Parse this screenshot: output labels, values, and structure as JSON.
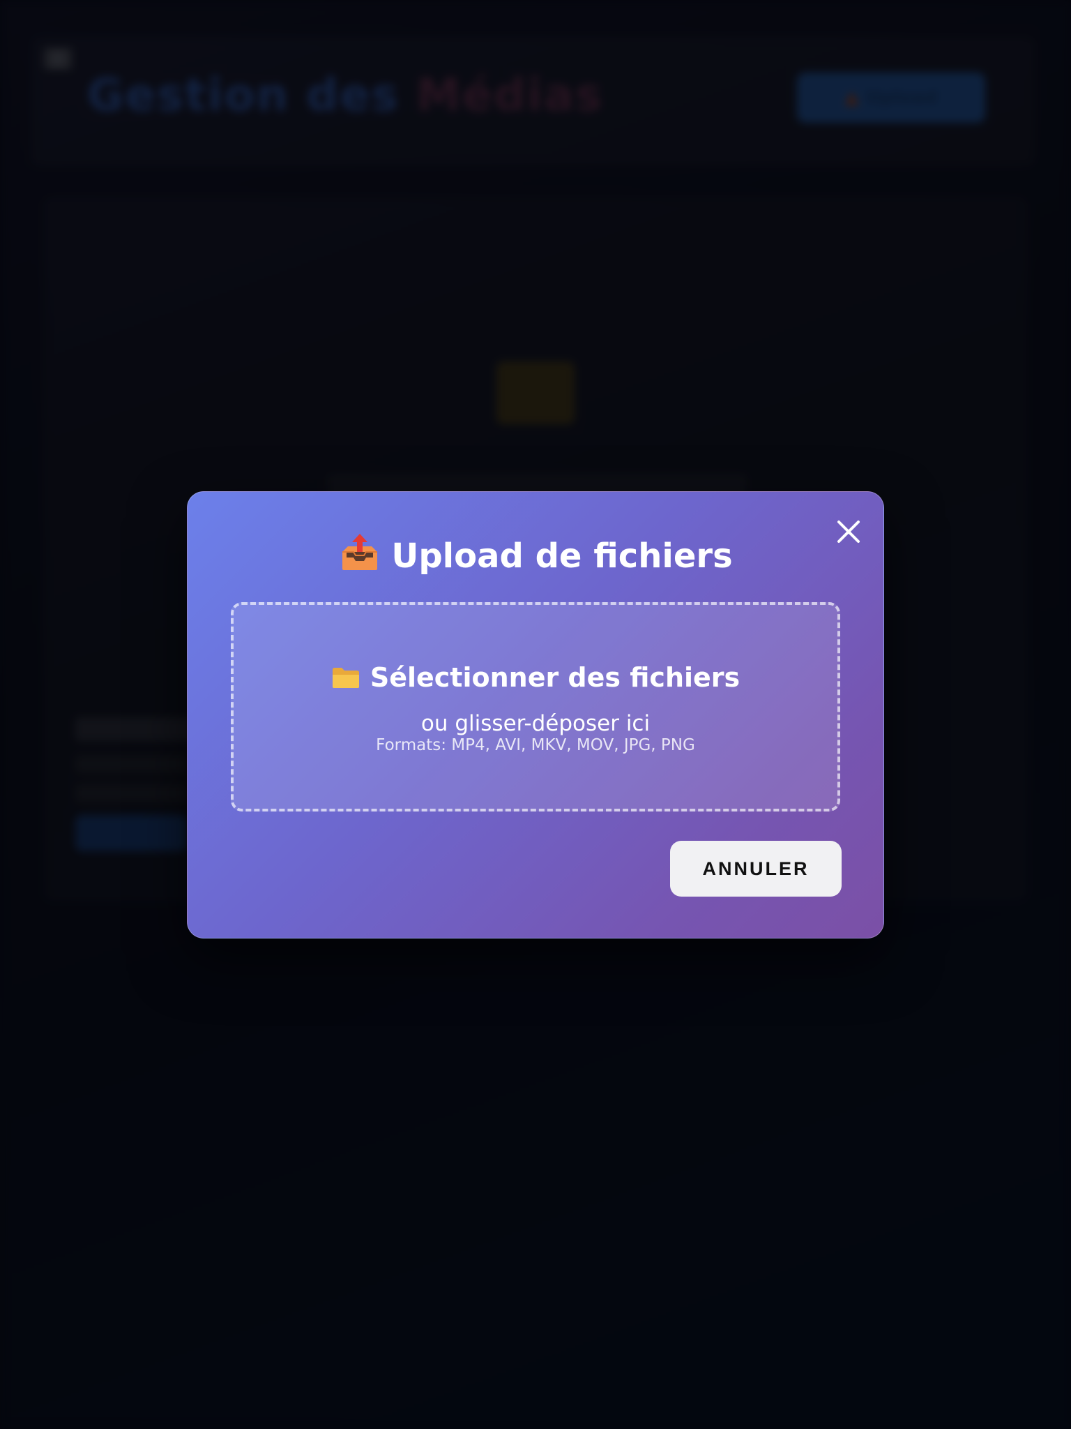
{
  "background": {
    "page_title_part1": "Gestion des ",
    "page_title_part2": "Médias",
    "upload_button_label": "Upload",
    "upload_button_icon": "outbox-tray-icon",
    "hamburger_icon": "menu-icon",
    "empty_state_icon": "folder-icon"
  },
  "modal": {
    "title": "Upload de fichiers",
    "title_icon": "outbox-tray-icon",
    "close_icon": "close-icon",
    "dropzone": {
      "main_label": "Sélectionner des fichiers",
      "icon": "folder-icon",
      "sub_label": "ou glisser-déposer ici",
      "formats": "Formats: MP4, AVI, MKV, MOV, JPG, PNG"
    },
    "cancel_label": "ANNULER"
  },
  "colors": {
    "modal_gradient_start": "#6c80ea",
    "modal_gradient_end": "#7b50a6",
    "cancel_button_bg": "#f1f1f3",
    "page_background": "#070914"
  }
}
